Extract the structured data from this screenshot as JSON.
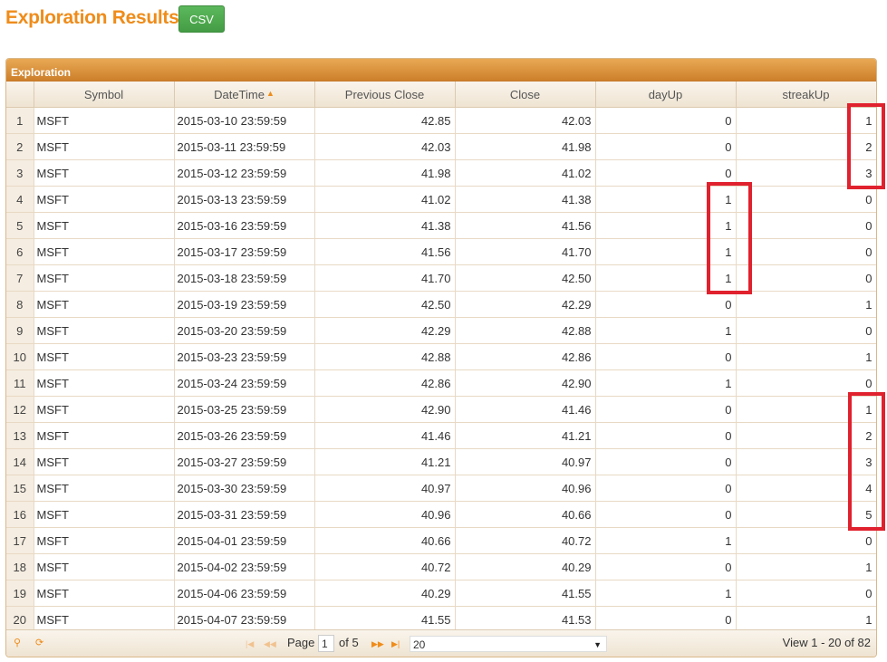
{
  "header": {
    "title": "Exploration Results",
    "csv_label": "CSV"
  },
  "grid": {
    "caption": "Exploration",
    "columns": [
      "",
      "Symbol",
      "DateTime",
      "Previous Close",
      "Close",
      "dayUp",
      "streakUp"
    ],
    "sort_indicator": "▲",
    "rows": [
      [
        "1",
        "MSFT",
        "2015-03-10 23:59:59",
        "42.85",
        "42.03",
        "0",
        "1"
      ],
      [
        "2",
        "MSFT",
        "2015-03-11 23:59:59",
        "42.03",
        "41.98",
        "0",
        "2"
      ],
      [
        "3",
        "MSFT",
        "2015-03-12 23:59:59",
        "41.98",
        "41.02",
        "0",
        "3"
      ],
      [
        "4",
        "MSFT",
        "2015-03-13 23:59:59",
        "41.02",
        "41.38",
        "1",
        "0"
      ],
      [
        "5",
        "MSFT",
        "2015-03-16 23:59:59",
        "41.38",
        "41.56",
        "1",
        "0"
      ],
      [
        "6",
        "MSFT",
        "2015-03-17 23:59:59",
        "41.56",
        "41.70",
        "1",
        "0"
      ],
      [
        "7",
        "MSFT",
        "2015-03-18 23:59:59",
        "41.70",
        "42.50",
        "1",
        "0"
      ],
      [
        "8",
        "MSFT",
        "2015-03-19 23:59:59",
        "42.50",
        "42.29",
        "0",
        "1"
      ],
      [
        "9",
        "MSFT",
        "2015-03-20 23:59:59",
        "42.29",
        "42.88",
        "1",
        "0"
      ],
      [
        "10",
        "MSFT",
        "2015-03-23 23:59:59",
        "42.88",
        "42.86",
        "0",
        "1"
      ],
      [
        "11",
        "MSFT",
        "2015-03-24 23:59:59",
        "42.86",
        "42.90",
        "1",
        "0"
      ],
      [
        "12",
        "MSFT",
        "2015-03-25 23:59:59",
        "42.90",
        "41.46",
        "0",
        "1"
      ],
      [
        "13",
        "MSFT",
        "2015-03-26 23:59:59",
        "41.46",
        "41.21",
        "0",
        "2"
      ],
      [
        "14",
        "MSFT",
        "2015-03-27 23:59:59",
        "41.21",
        "40.97",
        "0",
        "3"
      ],
      [
        "15",
        "MSFT",
        "2015-03-30 23:59:59",
        "40.97",
        "40.96",
        "0",
        "4"
      ],
      [
        "16",
        "MSFT",
        "2015-03-31 23:59:59",
        "40.96",
        "40.66",
        "0",
        "5"
      ],
      [
        "17",
        "MSFT",
        "2015-04-01 23:59:59",
        "40.66",
        "40.72",
        "1",
        "0"
      ],
      [
        "18",
        "MSFT",
        "2015-04-02 23:59:59",
        "40.72",
        "40.29",
        "0",
        "1"
      ],
      [
        "19",
        "MSFT",
        "2015-04-06 23:59:59",
        "40.29",
        "41.55",
        "1",
        "0"
      ],
      [
        "20",
        "MSFT",
        "2015-04-07 23:59:59",
        "41.55",
        "41.53",
        "0",
        "1"
      ]
    ]
  },
  "pager": {
    "search_icon": "search-icon",
    "refresh_icon": "refresh-icon",
    "page_label": "Page",
    "page_value": "1",
    "of_label": "of 5",
    "rows_per_page": "20",
    "view_text": "View 1 - 20 of 82"
  },
  "colors": {
    "accent": "#ef8c1a",
    "csv_button": "#5cb85c",
    "highlight_box": "#e0212e"
  }
}
